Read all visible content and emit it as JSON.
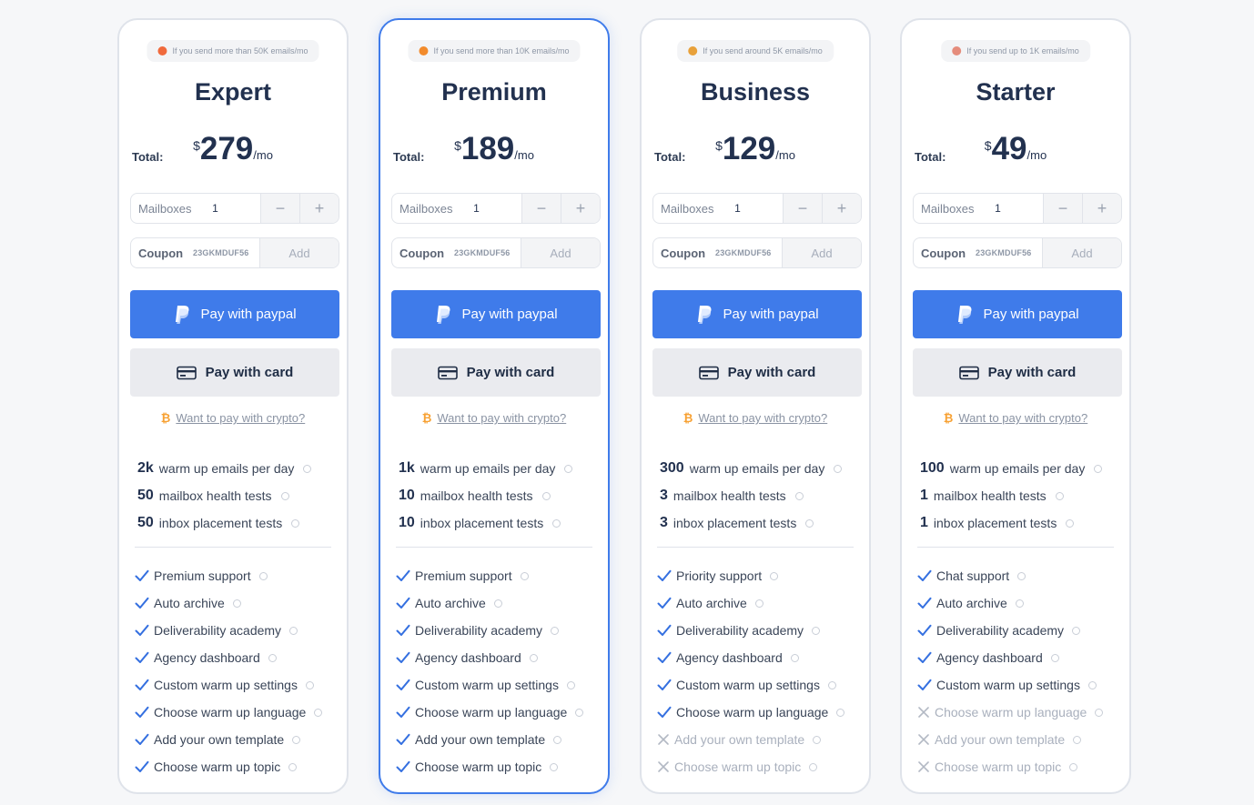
{
  "colors": {
    "accent": "#3f7bea",
    "featured_border": "#3f7bea",
    "check": "#3570e0",
    "bitcoin": "#f7a133"
  },
  "common": {
    "total_label": "Total:",
    "currency": "$",
    "period": "/mo",
    "mailboxes_label": "Mailboxes",
    "mailboxes_value": "1",
    "minus": "−",
    "plus": "+",
    "coupon_label": "Coupon",
    "coupon_code": "23GKMDUF56",
    "add_label": "Add",
    "paypal_label": "Pay with paypal",
    "card_label": "Pay with card",
    "crypto_label": "Want to pay with crypto?",
    "crypto_symbol": "₿"
  },
  "plans": [
    {
      "name": "Expert",
      "badge": "If you send more than 50K emails/mo",
      "badge_icon": "rocket-icon",
      "price": "279",
      "featured": false,
      "stats": [
        {
          "num": "2k",
          "label": "warm up emails per day"
        },
        {
          "num": "50",
          "label": "mailbox health tests"
        },
        {
          "num": "50",
          "label": "inbox placement tests"
        }
      ],
      "features": [
        {
          "label": "Premium support",
          "included": true
        },
        {
          "label": "Auto archive",
          "included": true
        },
        {
          "label": "Deliverability academy",
          "included": true
        },
        {
          "label": "Agency dashboard",
          "included": true
        },
        {
          "label": "Custom warm up settings",
          "included": true
        },
        {
          "label": "Choose warm up language",
          "included": true
        },
        {
          "label": "Add your own template",
          "included": true
        },
        {
          "label": "Choose warm up topic",
          "included": true
        }
      ]
    },
    {
      "name": "Premium",
      "badge": "If you send more than 10K emails/mo",
      "badge_icon": "comet-icon",
      "price": "189",
      "featured": true,
      "stats": [
        {
          "num": "1k",
          "label": "warm up emails per day"
        },
        {
          "num": "10",
          "label": "mailbox health tests"
        },
        {
          "num": "10",
          "label": "inbox placement tests"
        }
      ],
      "features": [
        {
          "label": "Premium support",
          "included": true
        },
        {
          "label": "Auto archive",
          "included": true
        },
        {
          "label": "Deliverability academy",
          "included": true
        },
        {
          "label": "Agency dashboard",
          "included": true
        },
        {
          "label": "Custom warm up settings",
          "included": true
        },
        {
          "label": "Choose warm up language",
          "included": true
        },
        {
          "label": "Add your own template",
          "included": true
        },
        {
          "label": "Choose warm up topic",
          "included": true
        }
      ]
    },
    {
      "name": "Business",
      "badge": "If you send around 5K emails/mo",
      "badge_icon": "party-icon",
      "price": "129",
      "featured": false,
      "stats": [
        {
          "num": "300",
          "label": "warm up emails per day"
        },
        {
          "num": "3",
          "label": "mailbox health tests"
        },
        {
          "num": "3",
          "label": "inbox placement tests"
        }
      ],
      "features": [
        {
          "label": "Priority support",
          "included": true
        },
        {
          "label": "Auto archive",
          "included": true
        },
        {
          "label": "Deliverability academy",
          "included": true
        },
        {
          "label": "Agency dashboard",
          "included": true
        },
        {
          "label": "Custom warm up settings",
          "included": true
        },
        {
          "label": "Choose warm up language",
          "included": true
        },
        {
          "label": "Add your own template",
          "included": false
        },
        {
          "label": "Choose warm up topic",
          "included": false
        }
      ]
    },
    {
      "name": "Starter",
      "badge": "If you send up to 1K emails/mo",
      "badge_icon": "person-icon",
      "price": "49",
      "featured": false,
      "stats": [
        {
          "num": "100",
          "label": "warm up emails per day"
        },
        {
          "num": "1",
          "label": "mailbox health tests"
        },
        {
          "num": "1",
          "label": "inbox placement tests"
        }
      ],
      "features": [
        {
          "label": "Chat support",
          "included": true
        },
        {
          "label": "Auto archive",
          "included": true
        },
        {
          "label": "Deliverability academy",
          "included": true
        },
        {
          "label": "Agency dashboard",
          "included": true
        },
        {
          "label": "Custom warm up settings",
          "included": true
        },
        {
          "label": "Choose warm up language",
          "included": false
        },
        {
          "label": "Add your own template",
          "included": false
        },
        {
          "label": "Choose warm up topic",
          "included": false
        }
      ]
    }
  ]
}
